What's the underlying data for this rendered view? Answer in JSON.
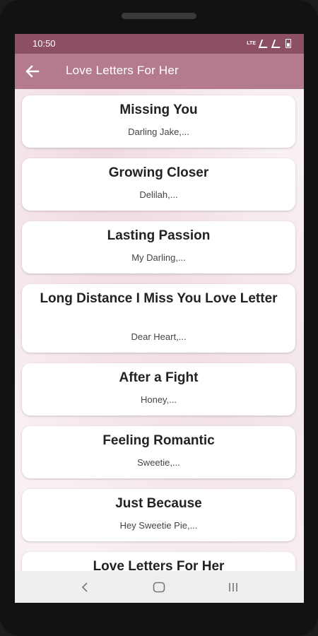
{
  "status_bar": {
    "time": "10:50",
    "network": "LTE"
  },
  "app_bar": {
    "title": "Love Letters For Her",
    "back_icon": "arrow-left-icon"
  },
  "letters": [
    {
      "title": "Missing You",
      "preview": "Darling Jake,..."
    },
    {
      "title": "Growing Closer",
      "preview": "Delilah,..."
    },
    {
      "title": "Lasting Passion",
      "preview": "My Darling,..."
    },
    {
      "title": "Long Distance I Miss You Love Letter",
      "preview": "Dear Heart,..."
    },
    {
      "title": "After a Fight",
      "preview": "Honey,..."
    },
    {
      "title": "Feeling Romantic",
      "preview": "Sweetie,..."
    },
    {
      "title": "Just Because",
      "preview": "Hey Sweetie Pie,..."
    },
    {
      "title": "Love Letters For Her",
      "preview": ""
    }
  ],
  "nav_bar": {
    "back_icon": "nav-back-icon",
    "home_icon": "nav-home-icon",
    "recents_icon": "nav-recents-icon"
  },
  "colors": {
    "status_bar": "#8d4f66",
    "app_bar": "#b47a90",
    "card": "#ffffff"
  }
}
